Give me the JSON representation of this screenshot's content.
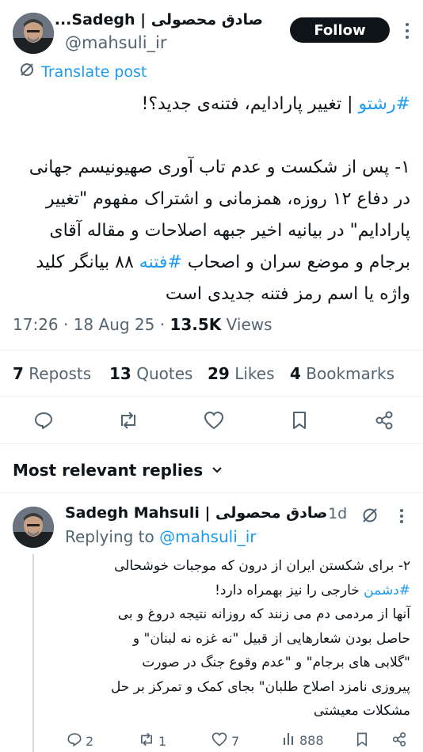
{
  "post": {
    "author_name": "صادق محصولی | Sadegh...",
    "author_handle": "@mahsuli_ir",
    "follow_label": "Follow",
    "translate_label": "Translate post",
    "hashtag_title": "#رشتو",
    "title_rest": " | تغییر پارادایم، فتنه‌ی جدید؟!",
    "body_line1": "۱- پس از شکست و عدم تاب آوری صهیونیسم جهانی",
    "body_line2": "در دفاع ۱۲ روزه، همزمانی و اشتراک مفهوم \"تغییر",
    "body_line3": "پارادایم\" در بیانیه اخیر جبهه اصلاحات و مقاله آقای",
    "body_line4_a": "برجام و موضع سران و اصحاب ",
    "body_line4_tag": "#فتنه",
    "body_line4_b": " ۸۸ بیانگر کلید",
    "body_line5": "واژه یا اسم رمز فتنه جدیدی است",
    "time": "17:26 · 18 Aug 25 · ",
    "views_count": "13.5K",
    "views_label": " Views",
    "stats": {
      "reposts_count": "7",
      "reposts_label": " Reposts",
      "quotes_count": "13",
      "quotes_label": " Quotes",
      "likes_count": "29",
      "likes_label": " Likes",
      "bookmarks_count": "4",
      "bookmarks_label": " Bookmarks"
    }
  },
  "replies_section": {
    "title": "Most relevant replies"
  },
  "reply": {
    "author_name": "Sadegh Mahsuli | صادق محصولی",
    "time": "· 1d",
    "replying_to_label": "Replying to ",
    "replying_to_handle": "@mahsuli_ir",
    "line1": "۲- برای شکستن ایران از درون که موجبات خوشحالی",
    "line2_tag": "#دشمن",
    "line2_rest": " خارجی را نیز بهمراه دارد!",
    "line3": "آنها از مردمی دم می زنند که روزانه نتیجه دروغ و بی",
    "line4": "حاصل بودن شعارهایی از قبیل \"نه غزه نه لبنان\" و",
    "line5": "\"گلابی های برجام\" و \"عدم وقوع جنگ در صورت",
    "line6": "پیروزی نامزد اصلاح طلبان\" بجای کمک و تمرکز بر حل",
    "line7": "مشکلات معیشتی",
    "actions": {
      "replies": "2",
      "reposts": "1",
      "likes": "7",
      "views": "888"
    }
  },
  "colors": {
    "accent": "#1d9bf0",
    "text": "#0f1419",
    "muted": "#536471",
    "divider": "#eff3f4"
  }
}
